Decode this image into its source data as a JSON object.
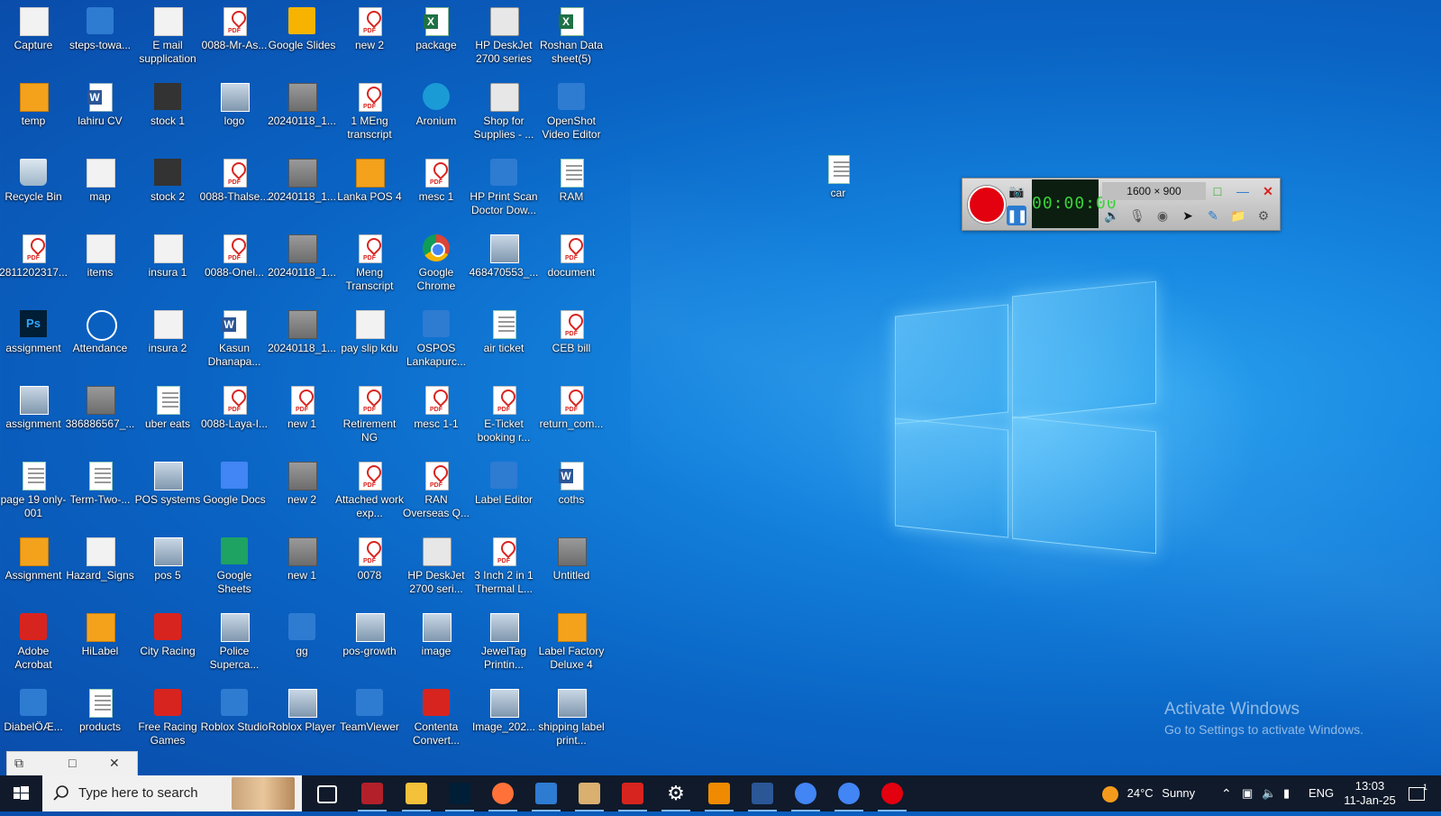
{
  "desktop": {
    "icons": [
      {
        "label": "Capture",
        "col": 0,
        "row": 0,
        "kind": "flat"
      },
      {
        "label": "temp",
        "col": 0,
        "row": 1,
        "kind": "orange"
      },
      {
        "label": "Recycle Bin",
        "col": 0,
        "row": 2,
        "kind": "bin"
      },
      {
        "label": "2811202317...",
        "col": 0,
        "row": 3,
        "kind": "pdf"
      },
      {
        "label": "assignment",
        "col": 0,
        "row": 4,
        "kind": "ps"
      },
      {
        "label": "assignment",
        "col": 0,
        "row": 5,
        "kind": "img"
      },
      {
        "label": "page 19 only-001",
        "col": 0,
        "row": 6,
        "kind": "doc"
      },
      {
        "label": "Assignment",
        "col": 0,
        "row": 7,
        "kind": "orange"
      },
      {
        "label": "Adobe Acrobat",
        "col": 0,
        "row": 8,
        "kind": "red"
      },
      {
        "label": "DiabelÖÆ...",
        "col": 0,
        "row": 9,
        "kind": "blue"
      },
      {
        "label": "steps-towa...",
        "col": 1,
        "row": 0,
        "kind": "blue"
      },
      {
        "label": "lahiru CV",
        "col": 1,
        "row": 1,
        "kind": "word"
      },
      {
        "label": "map",
        "col": 1,
        "row": 2,
        "kind": "flat"
      },
      {
        "label": "items",
        "col": 1,
        "row": 3,
        "kind": "flat"
      },
      {
        "label": "Attendance",
        "col": 1,
        "row": 4,
        "kind": "clock"
      },
      {
        "label": "386886567_...",
        "col": 1,
        "row": 5,
        "kind": "gray"
      },
      {
        "label": "Term-Two-...",
        "col": 1,
        "row": 6,
        "kind": "doc"
      },
      {
        "label": "Hazard_Signs",
        "col": 1,
        "row": 7,
        "kind": "flat"
      },
      {
        "label": "HiLabel",
        "col": 1,
        "row": 8,
        "kind": "orange"
      },
      {
        "label": "products",
        "col": 1,
        "row": 9,
        "kind": "doc"
      },
      {
        "label": "E mail supplication",
        "col": 2,
        "row": 0,
        "kind": "flat"
      },
      {
        "label": "stock 1",
        "col": 2,
        "row": 1,
        "kind": "dark"
      },
      {
        "label": "stock 2",
        "col": 2,
        "row": 2,
        "kind": "dark"
      },
      {
        "label": "insura 1",
        "col": 2,
        "row": 3,
        "kind": "flat"
      },
      {
        "label": "insura 2",
        "col": 2,
        "row": 4,
        "kind": "flat"
      },
      {
        "label": "uber eats",
        "col": 2,
        "row": 5,
        "kind": "doc"
      },
      {
        "label": "POS systems",
        "col": 2,
        "row": 6,
        "kind": "img"
      },
      {
        "label": "pos 5",
        "col": 2,
        "row": 7,
        "kind": "img"
      },
      {
        "label": "City Racing",
        "col": 2,
        "row": 8,
        "kind": "red"
      },
      {
        "label": "Free Racing Games",
        "col": 2,
        "row": 9,
        "kind": "red"
      },
      {
        "label": "0088-Mr-As...",
        "col": 3,
        "row": 0,
        "kind": "pdf"
      },
      {
        "label": "logo",
        "col": 3,
        "row": 1,
        "kind": "img"
      },
      {
        "label": "0088-Thalse...",
        "col": 3,
        "row": 2,
        "kind": "pdf"
      },
      {
        "label": "0088-Onel...",
        "col": 3,
        "row": 3,
        "kind": "pdf"
      },
      {
        "label": "Kasun Dhanapa...",
        "col": 3,
        "row": 4,
        "kind": "word"
      },
      {
        "label": "0088-Laya-I...",
        "col": 3,
        "row": 5,
        "kind": "pdf"
      },
      {
        "label": "Google Docs",
        "col": 3,
        "row": 6,
        "kind": "gdocs"
      },
      {
        "label": "Google Sheets",
        "col": 3,
        "row": 7,
        "kind": "gsheets"
      },
      {
        "label": "Police Superca...",
        "col": 3,
        "row": 8,
        "kind": "img"
      },
      {
        "label": "Roblox Studio",
        "col": 3,
        "row": 9,
        "kind": "blue"
      },
      {
        "label": "Google Slides",
        "col": 4,
        "row": 0,
        "kind": "gslides"
      },
      {
        "label": "20240118_1...",
        "col": 4,
        "row": 1,
        "kind": "gray"
      },
      {
        "label": "20240118_1...",
        "col": 4,
        "row": 2,
        "kind": "gray"
      },
      {
        "label": "20240118_1...",
        "col": 4,
        "row": 3,
        "kind": "gray"
      },
      {
        "label": "20240118_1...",
        "col": 4,
        "row": 4,
        "kind": "gray"
      },
      {
        "label": "new 1",
        "col": 4,
        "row": 5,
        "kind": "pdf"
      },
      {
        "label": "new 2",
        "col": 4,
        "row": 6,
        "kind": "gray"
      },
      {
        "label": "new 1",
        "col": 4,
        "row": 7,
        "kind": "gray"
      },
      {
        "label": "gg",
        "col": 4,
        "row": 8,
        "kind": "blue"
      },
      {
        "label": "Roblox Player",
        "col": 4,
        "row": 9,
        "kind": "img"
      },
      {
        "label": "new 2",
        "col": 5,
        "row": 0,
        "kind": "pdf"
      },
      {
        "label": "1 MEng transcript",
        "col": 5,
        "row": 1,
        "kind": "pdf"
      },
      {
        "label": "Lanka POS 4",
        "col": 5,
        "row": 2,
        "kind": "orange"
      },
      {
        "label": "Meng Transcript",
        "col": 5,
        "row": 3,
        "kind": "pdf"
      },
      {
        "label": "pay slip kdu",
        "col": 5,
        "row": 4,
        "kind": "flat"
      },
      {
        "label": "Retirement NG",
        "col": 5,
        "row": 5,
        "kind": "pdf"
      },
      {
        "label": "Attached work exp...",
        "col": 5,
        "row": 6,
        "kind": "pdf"
      },
      {
        "label": "0078",
        "col": 5,
        "row": 7,
        "kind": "pdf"
      },
      {
        "label": "pos-growth",
        "col": 5,
        "row": 8,
        "kind": "img"
      },
      {
        "label": "TeamViewer",
        "col": 5,
        "row": 9,
        "kind": "blue"
      },
      {
        "label": "package",
        "col": 6,
        "row": 0,
        "kind": "xls"
      },
      {
        "label": "Aronium",
        "col": 6,
        "row": 1,
        "kind": "teal"
      },
      {
        "label": "mesc 1",
        "col": 6,
        "row": 2,
        "kind": "pdf"
      },
      {
        "label": "Google Chrome",
        "col": 6,
        "row": 3,
        "kind": "chrome"
      },
      {
        "label": "OSPOS Lankapurc...",
        "col": 6,
        "row": 4,
        "kind": "blue"
      },
      {
        "label": "mesc 1-1",
        "col": 6,
        "row": 5,
        "kind": "pdf"
      },
      {
        "label": "RAN Overseas Q...",
        "col": 6,
        "row": 6,
        "kind": "pdf"
      },
      {
        "label": "HP DeskJet 2700 seri...",
        "col": 6,
        "row": 7,
        "kind": "print"
      },
      {
        "label": "image",
        "col": 6,
        "row": 8,
        "kind": "img"
      },
      {
        "label": "Contenta Convert...",
        "col": 6,
        "row": 9,
        "kind": "red"
      },
      {
        "label": "HP DeskJet 2700 series",
        "col": 7,
        "row": 0,
        "kind": "print"
      },
      {
        "label": "Shop for Supplies - ...",
        "col": 7,
        "row": 1,
        "kind": "print"
      },
      {
        "label": "HP Print Scan Doctor Dow...",
        "col": 7,
        "row": 2,
        "kind": "blue"
      },
      {
        "label": "468470553_...",
        "col": 7,
        "row": 3,
        "kind": "img"
      },
      {
        "label": "air ticket",
        "col": 7,
        "row": 4,
        "kind": "doc"
      },
      {
        "label": "E-Ticket booking r...",
        "col": 7,
        "row": 5,
        "kind": "pdf"
      },
      {
        "label": "Label Editor",
        "col": 7,
        "row": 6,
        "kind": "blue"
      },
      {
        "label": "3 Inch 2 in 1 Thermal L...",
        "col": 7,
        "row": 7,
        "kind": "pdf"
      },
      {
        "label": "JewelTag Printin...",
        "col": 7,
        "row": 8,
        "kind": "img"
      },
      {
        "label": "Image_202...",
        "col": 7,
        "row": 9,
        "kind": "img"
      },
      {
        "label": "Roshan Data sheet(5)",
        "col": 8,
        "row": 0,
        "kind": "xls"
      },
      {
        "label": "OpenShot Video Editor",
        "col": 8,
        "row": 1,
        "kind": "blue"
      },
      {
        "label": "RAM",
        "col": 8,
        "row": 2,
        "kind": "doc"
      },
      {
        "label": "document",
        "col": 8,
        "row": 3,
        "kind": "pdf"
      },
      {
        "label": "CEB bill",
        "col": 8,
        "row": 4,
        "kind": "pdf"
      },
      {
        "label": "return_com...",
        "col": 8,
        "row": 5,
        "kind": "pdf"
      },
      {
        "label": "coths",
        "col": 8,
        "row": 6,
        "kind": "word"
      },
      {
        "label": "Untitled",
        "col": 8,
        "row": 7,
        "kind": "gray"
      },
      {
        "label": "Label Factory Deluxe 4",
        "col": 8,
        "row": 8,
        "kind": "orange"
      },
      {
        "label": "shipping label print...",
        "col": 8,
        "row": 9,
        "kind": "img"
      }
    ],
    "extra_icon": {
      "label": "car",
      "kind": "doc"
    }
  },
  "recorder": {
    "size_label": "1600 × 900",
    "timer": "00:00:00"
  },
  "watermark": {
    "title": "Activate Windows",
    "subtitle": "Go to Settings to activate Windows."
  },
  "taskbar": {
    "search_placeholder": "Type here to search",
    "apps": [
      {
        "name": "task-view",
        "color": "#ffffff"
      },
      {
        "name": "mendeley",
        "color": "#b3202a"
      },
      {
        "name": "file-explorer",
        "color": "#f3c13a"
      },
      {
        "name": "photoshop",
        "color": "#001e36"
      },
      {
        "name": "firefox",
        "color": "#ff7139"
      },
      {
        "name": "ospos",
        "color": "#2e7bd2"
      },
      {
        "name": "popup-app",
        "color": "#d9b070"
      },
      {
        "name": "acrobat",
        "color": "#d8241f"
      },
      {
        "name": "settings",
        "color": "#ffffff"
      },
      {
        "name": "vlc",
        "color": "#f08a00"
      },
      {
        "name": "word",
        "color": "#2b5797"
      },
      {
        "name": "chrome-profile",
        "color": "#4285f4"
      },
      {
        "name": "chrome",
        "color": "#4285f4"
      },
      {
        "name": "recorder",
        "color": "#e3000f"
      }
    ],
    "weather": {
      "temp": "24°C",
      "condition": "Sunny"
    },
    "language": "ENG",
    "time": "13:03",
    "date": "11-Jan-25",
    "notification_count": "1"
  }
}
